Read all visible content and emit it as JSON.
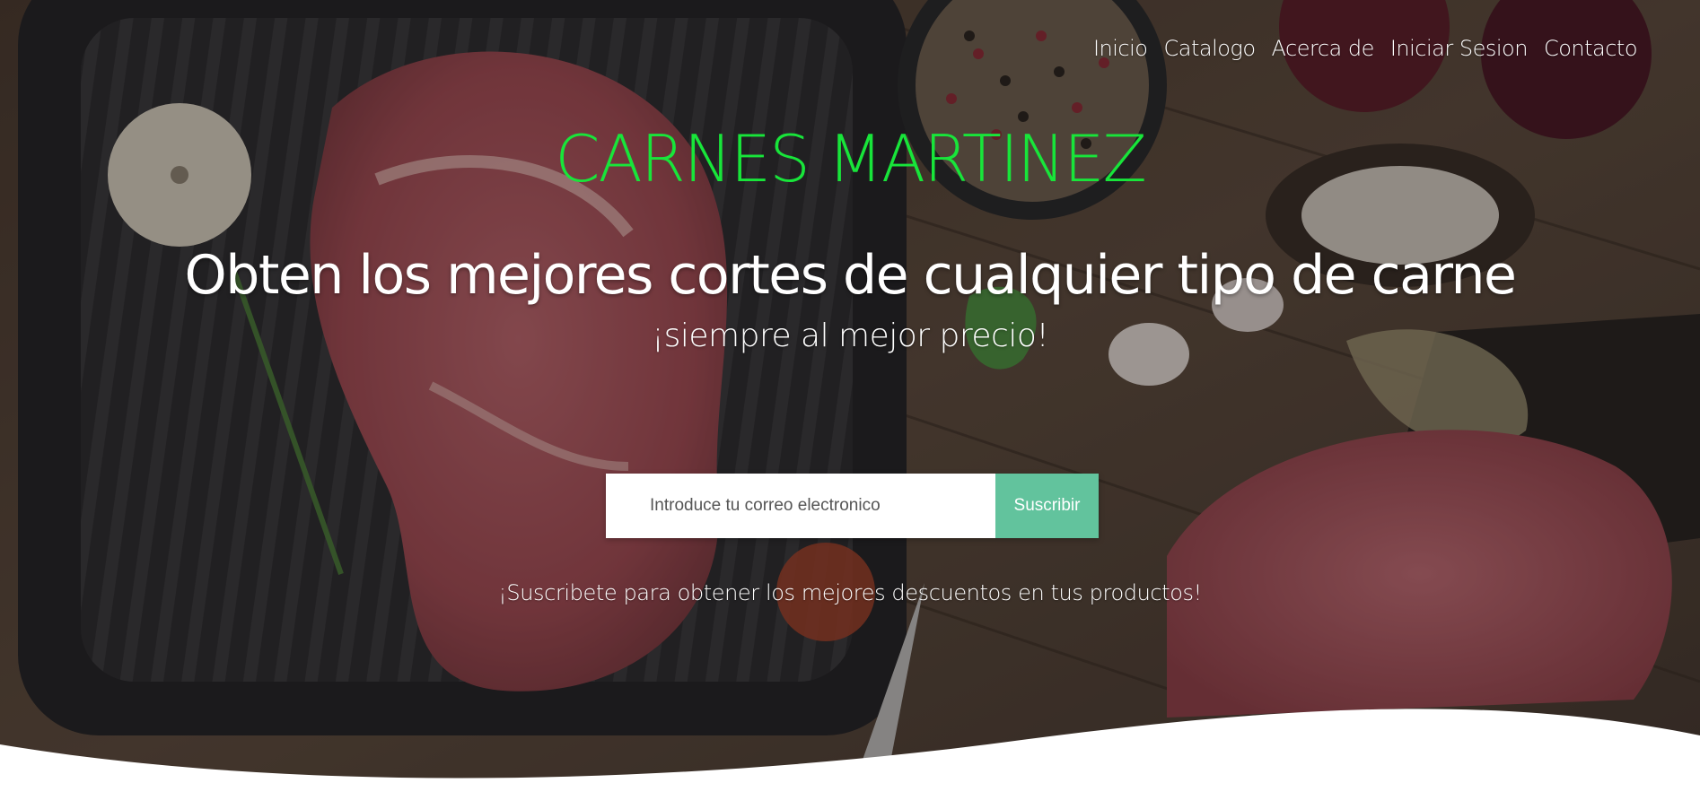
{
  "nav": {
    "items": [
      {
        "label": "Inicio"
      },
      {
        "label": "Catalogo"
      },
      {
        "label": "Acerca de"
      },
      {
        "label": "Iniciar Sesion"
      },
      {
        "label": "Contacto"
      }
    ]
  },
  "hero": {
    "brand": "CARNES MARTINEZ",
    "headline": "Obten los mejores cortes de cualquier tipo de carne",
    "subheadline": "¡siempre al mejor precio!",
    "promo": "¡Suscribete para obtener los mejores descuentos en tus productos!",
    "background": "meat-and-spices-photo"
  },
  "subscribe": {
    "email_placeholder": "Introduce tu correo electronico",
    "email_value": "",
    "button_label": "Suscribir"
  },
  "colors": {
    "brand": "#18e53a",
    "button": "#62c39d",
    "text": "#ffffff"
  }
}
